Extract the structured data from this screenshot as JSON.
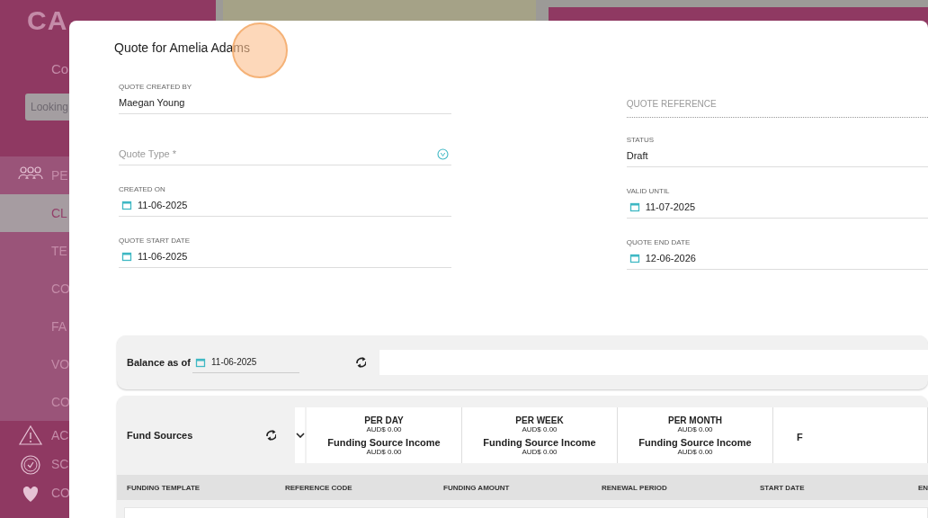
{
  "background": {
    "logo": "CA",
    "subtitle": "Co",
    "search": {
      "placeholder": "Looking"
    },
    "sidebar": [
      {
        "kind": "section",
        "label": "PE",
        "selected": false
      },
      {
        "kind": "subitem",
        "label": "CL",
        "selected": true
      },
      {
        "kind": "subitem",
        "label": "TE",
        "selected": false
      },
      {
        "kind": "subitem",
        "label": "CO",
        "selected": false
      },
      {
        "kind": "subitem",
        "label": "FA",
        "selected": false
      },
      {
        "kind": "subitem",
        "label": "VO",
        "selected": false
      },
      {
        "kind": "subitem",
        "label": "CO",
        "selected": false
      },
      {
        "kind": "section",
        "label": "AC",
        "selected": false
      },
      {
        "kind": "section",
        "label": "SC",
        "selected": false
      },
      {
        "kind": "section",
        "label": "CO",
        "selected": false
      }
    ]
  },
  "modal": {
    "title": "Quote for Amelia Adams",
    "left_fields": [
      {
        "kind": "text",
        "label": "QUOTE CREATED BY",
        "value": "Maegan Young"
      },
      {
        "kind": "select",
        "placeholder": "Quote Type *"
      },
      {
        "kind": "date",
        "label": "CREATED ON",
        "value": "11-06-2025"
      },
      {
        "kind": "date",
        "label": "QUOTE START DATE",
        "value": "11-06-2025"
      }
    ],
    "right_fields": [
      {
        "kind": "reference",
        "placeholder": "QUOTE REFERENCE"
      },
      {
        "kind": "text",
        "label": "STATUS",
        "value": "Draft"
      },
      {
        "kind": "date",
        "label": "VALID UNTIL",
        "value": "11-07-2025"
      },
      {
        "kind": "date",
        "label": "QUOTE END DATE",
        "value": "12-06-2026"
      }
    ],
    "balance": {
      "label": "Balance as of",
      "date": "11-06-2025"
    },
    "fund_sources": {
      "title": "Fund Sources",
      "summary": [
        {
          "heading": "PER DAY",
          "amount": "AUD$ 0.00",
          "income_label": "Funding Source Income",
          "income": "AUD$ 0.00"
        },
        {
          "heading": "PER WEEK",
          "amount": "AUD$ 0.00",
          "income_label": "Funding Source Income",
          "income": "AUD$ 0.00"
        },
        {
          "heading": "PER MONTH",
          "amount": "AUD$ 0.00",
          "income_label": "Funding Source Income",
          "income": "AUD$ 0.00"
        },
        {
          "income_label": "F"
        }
      ],
      "columns": [
        "FUNDING TEMPLATE",
        "REFERENCE CODE",
        "FUNDING AMOUNT",
        "RENEWAL PERIOD",
        "START DATE",
        "EN"
      ]
    }
  }
}
